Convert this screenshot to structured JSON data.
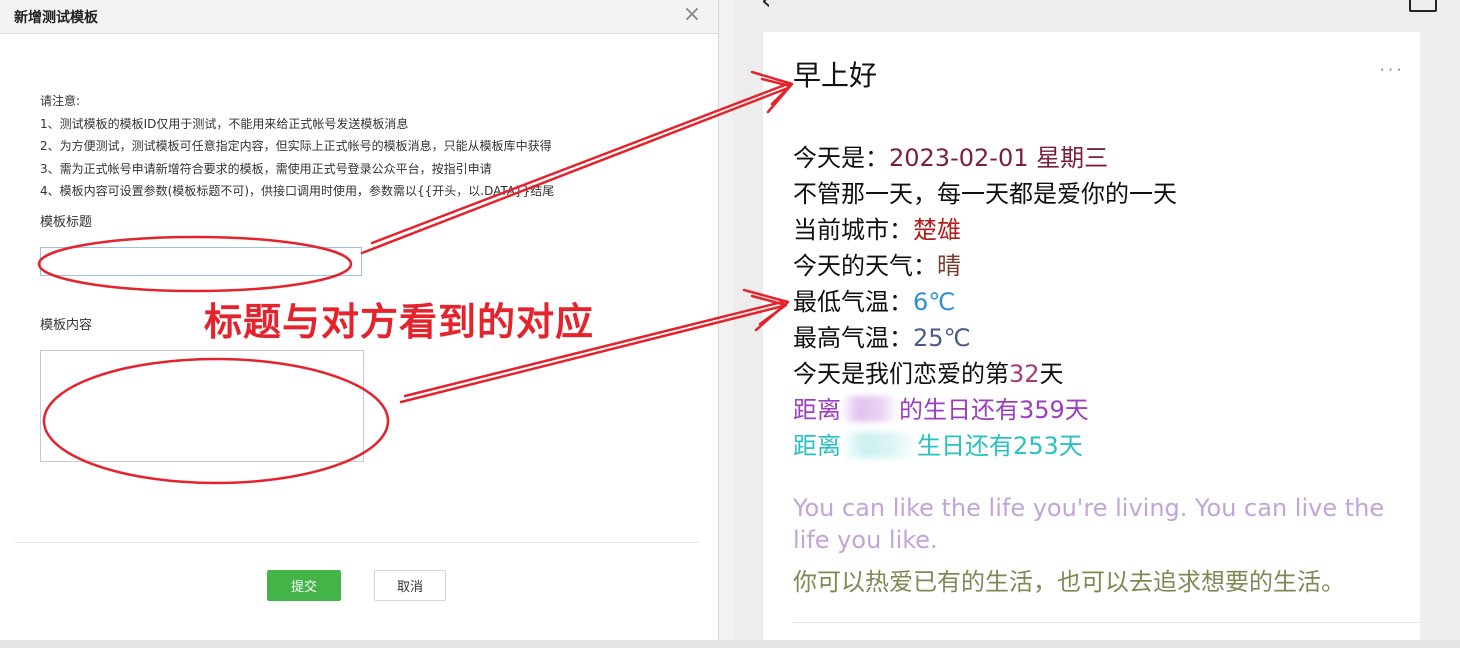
{
  "dialog": {
    "title": "新增测试模板",
    "close_label": "×",
    "notice_lines": [
      "请注意:",
      "1、测试模板的模板ID仅用于测试，不能用来给正式帐号发送模板消息",
      "2、为方便测试，测试模板可任意指定内容，但实际上正式帐号的模板消息，只能从模板库中获得",
      "3、需为正式帐号申请新增符合要求的模板，需使用正式号登录公众平台，按指引申请",
      "4、模板内容可设置参数(模板标题不可)，供接口调用时使用，参数需以{{开头，以.DATA}}结尾"
    ],
    "title_label": "模板标题",
    "title_value": "",
    "content_label": "模板内容",
    "content_value": "",
    "submit_label": "提交",
    "cancel_label": "取消"
  },
  "annotation": {
    "text": "标题与对方看到的对应",
    "color": "#e4232c"
  },
  "message": {
    "heading": "早上好",
    "more_icon": "···",
    "lines": {
      "date_prefix": "今天是：",
      "date_value": "2023-02-01 星期三",
      "love_line": "不管那一天，每一天都是爱你的一天",
      "city_prefix": "当前城市：",
      "city_value": "楚雄",
      "weather_prefix": "今天的天气：",
      "weather_value": "晴",
      "low_prefix": "最低气温：",
      "low_value": "6℃",
      "high_prefix": "最高气温：",
      "high_value": "25℃",
      "days_prefix": "今天是我们恋爱的第",
      "days_value": "32",
      "days_suffix": "天",
      "bday1_prefix": "距离",
      "bday1_suffix": "的生日还有359天",
      "bday2_prefix": "距离",
      "bday2_suffix": "生日还有253天"
    },
    "quote_en": "You can like the life you're living. You can live the life you like.",
    "quote_cn": "你可以热爱已有的生活，也可以去追求想要的生活。"
  },
  "colors": {
    "date": "#7a1f3d",
    "city": "#b01e1e",
    "weather": "#7a3b2e",
    "low_temp": "#2f8fd1",
    "high_temp": "#4a5a8a",
    "days": "#a43a7a",
    "bday1": "#9b3fc0",
    "bday2": "#27c1c1",
    "submit_bg": "#43b548"
  }
}
